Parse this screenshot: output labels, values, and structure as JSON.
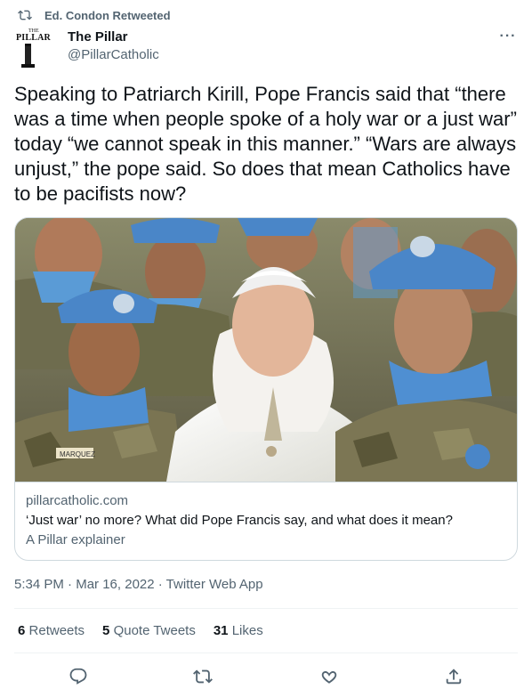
{
  "retweet_banner": {
    "text": "Ed. Condon Retweeted",
    "icon": "retweet-icon"
  },
  "author": {
    "name": "The Pillar",
    "handle": "@PillarCatholic",
    "avatar": {
      "logo_small": "THE",
      "logo_main": "PILLAR"
    }
  },
  "tweet": {
    "text": "Speaking to Patriarch Kirill, Pope Francis said that “there was a time when people spoke of a holy war or a just war” today “we cannot speak in this manner.” “Wars are always unjust,” the pope said. So does that mean Catholics have to be pacifists now?"
  },
  "card": {
    "image_badge": "MARQUEZ",
    "domain": "pillarcatholic.com",
    "title": "‘Just war’ no more? What did Pope Francis say, and what does it mean?",
    "description": "A Pillar explainer"
  },
  "timestamp": {
    "time": "5:34 PM",
    "separator": " · ",
    "date": "Mar 16, 2022",
    "client": "Twitter Web App"
  },
  "stats": {
    "retweets": {
      "count": "6",
      "label": "Retweets"
    },
    "quotes": {
      "count": "5",
      "label": "Quote Tweets"
    },
    "likes": {
      "count": "31",
      "label": "Likes"
    }
  },
  "actions": [
    "reply-icon",
    "retweet-icon",
    "like-icon",
    "share-icon"
  ],
  "colors": {
    "text": "#0f1419",
    "secondary": "#536471",
    "border": "#cfd9de",
    "helmet_blue": "#4a86c8"
  }
}
